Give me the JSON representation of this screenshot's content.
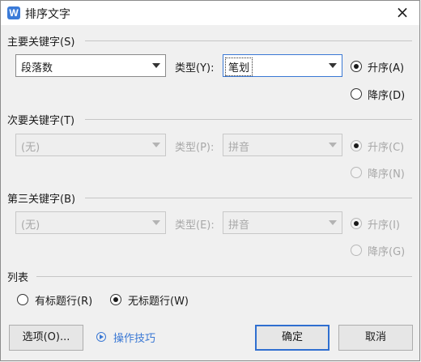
{
  "window": {
    "title": "排序文字",
    "app_icon_letter": "W",
    "close_glyph": "×"
  },
  "primary": {
    "heading": "主要关键字(S)",
    "field_value": "段落数",
    "type_label": "类型(Y):",
    "type_value": "笔划",
    "asc_label": "升序(A)",
    "desc_label": "降序(D)",
    "selected_order": "asc"
  },
  "secondary": {
    "heading": "次要关键字(T)",
    "field_value": "(无)",
    "type_label": "类型(P):",
    "type_value": "拼音",
    "asc_label": "升序(C)",
    "desc_label": "降序(N)",
    "enabled": false
  },
  "tertiary": {
    "heading": "第三关键字(B)",
    "field_value": "(无)",
    "type_label": "类型(E):",
    "type_value": "拼音",
    "asc_label": "升序(I)",
    "desc_label": "降序(G)",
    "enabled": false
  },
  "list": {
    "heading": "列表",
    "has_header_label": "有标题行(R)",
    "no_header_label": "无标题行(W)",
    "selected": "no_header"
  },
  "buttons": {
    "options_label": "选项(O)...",
    "tips_label": "操作技巧",
    "ok_label": "确定",
    "cancel_label": "取消"
  },
  "colors": {
    "accent": "#3a78d4",
    "app_icon": "#3b7bd8"
  }
}
